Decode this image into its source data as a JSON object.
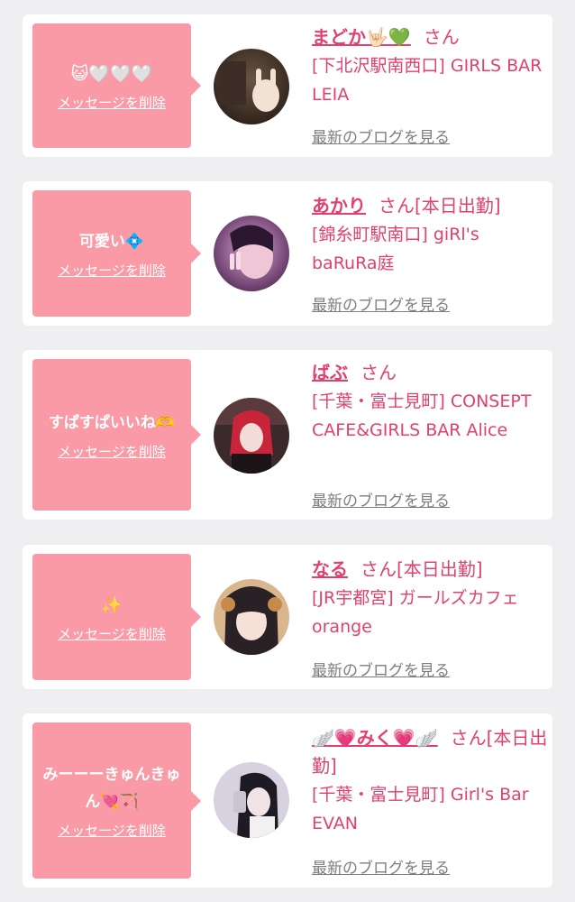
{
  "delete_label": "メッセージを削除",
  "blog_label": "最新のブログを見る",
  "honorific": "さん",
  "entries": [
    {
      "message": "😺🤍🤍🤍",
      "name": "まどか🤟🏻💚",
      "status": "",
      "shop": "[下北沢駅南西口] GIRLS BAR LEIA"
    },
    {
      "message": "可愛い💠",
      "name": "あかり",
      "status": "[本日出勤]",
      "shop": "[錦糸町駅南口] giRl's baRuRa庭"
    },
    {
      "message": "すぱすぱいいね🫶",
      "name": "ばぶ",
      "status": "",
      "shop": "[千葉・富士見町] CONSEPT CAFE&GIRLS BAR Alice"
    },
    {
      "message": "✨",
      "name": "なる",
      "status": "[本日出勤]",
      "shop": "[JR宇都宮] ガールズカフェ orange"
    },
    {
      "message": "みーーーきゅんきゅん💘🏹",
      "name": "🪽💗みく💗🪽",
      "status": "[本日出勤]",
      "shop": "[千葉・富士見町] Girl's Bar EVAN"
    }
  ],
  "colors": {
    "background": "#efeff1",
    "bubble": "#fa9aa6",
    "accent": "#e0416f",
    "link_gray": "#7d7d7d"
  }
}
